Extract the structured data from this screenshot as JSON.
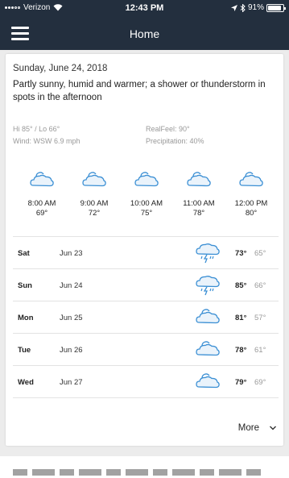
{
  "status": {
    "carrier": "Verizon",
    "time": "12:43 PM",
    "battery": "91%",
    "battery_level": 0.91
  },
  "header": {
    "title": "Home"
  },
  "forecast": {
    "date": "Sunday, June 24, 2018",
    "summary": "Partly sunny, humid and warmer; a shower or thunderstorm in spots in the afternoon",
    "hi_lo": "Hi 85° / Lo 66°",
    "wind": "Wind: WSW  6.9 mph",
    "realfeel": "RealFeel: 90°",
    "precipitation": "Precipitation: 40%"
  },
  "hourly": [
    {
      "time": "8:00 AM",
      "temp": "69°",
      "icon": "partly-cloudy-icon"
    },
    {
      "time": "9:00 AM",
      "temp": "72°",
      "icon": "partly-cloudy-icon"
    },
    {
      "time": "10:00 AM",
      "temp": "75°",
      "icon": "partly-cloudy-icon"
    },
    {
      "time": "11:00 AM",
      "temp": "78°",
      "icon": "partly-cloudy-icon"
    },
    {
      "time": "12:00 PM",
      "temp": "80°",
      "icon": "partly-cloudy-icon"
    }
  ],
  "daily": [
    {
      "day": "Sat",
      "date": "Jun 23",
      "high": "73°",
      "low": "65°",
      "icon": "thunderstorm-icon"
    },
    {
      "day": "Sun",
      "date": "Jun 24",
      "high": "85°",
      "low": "66°",
      "icon": "thunderstorm-icon"
    },
    {
      "day": "Mon",
      "date": "Jun 25",
      "high": "81°",
      "low": "57°",
      "icon": "partly-cloudy-icon"
    },
    {
      "day": "Tue",
      "date": "Jun 26",
      "high": "78°",
      "low": "61°",
      "icon": "partly-cloudy-icon"
    },
    {
      "day": "Wed",
      "date": "Jun 27",
      "high": "79°",
      "low": "69°",
      "icon": "partly-cloudy-icon"
    }
  ],
  "more_label": "More",
  "colors": {
    "header_bg": "#232f3e",
    "icon_blue": "#3b8fd4"
  }
}
